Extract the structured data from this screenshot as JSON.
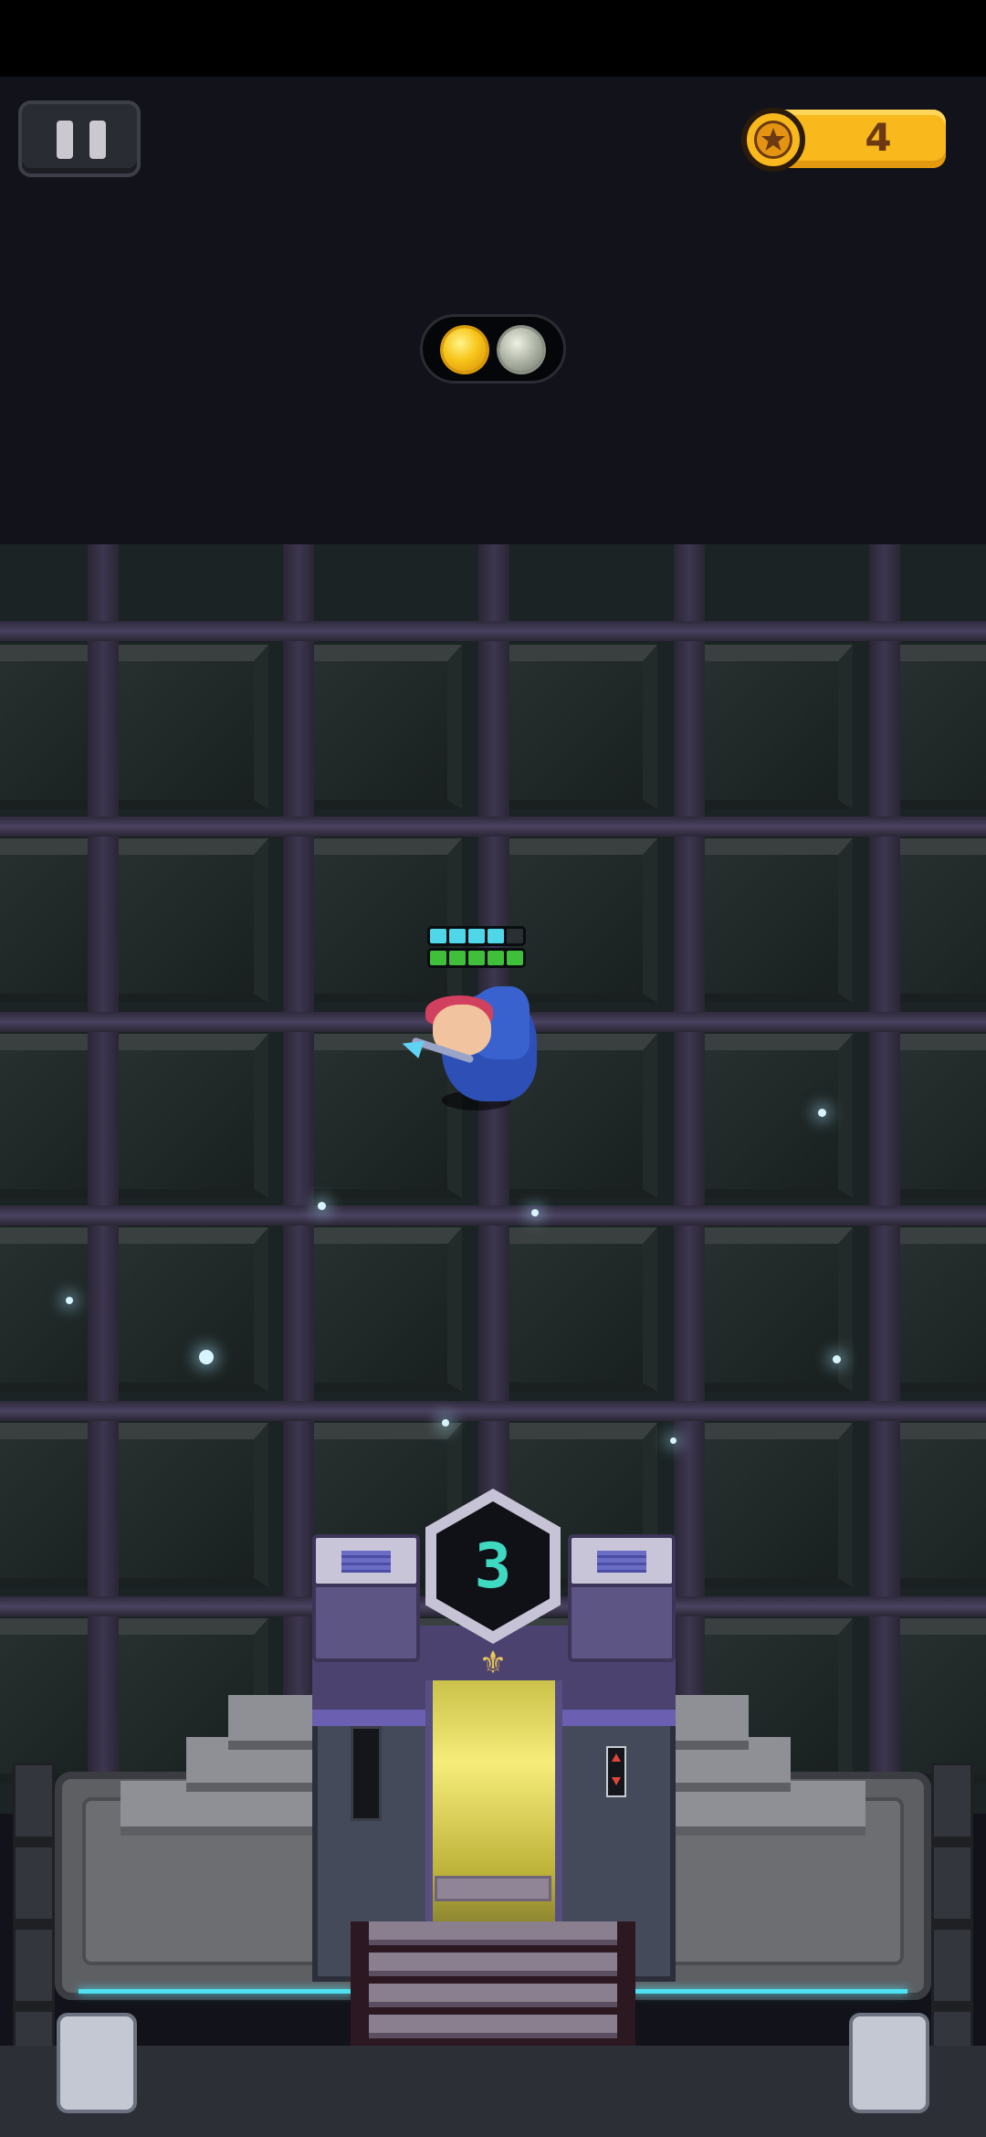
{
  "hud": {
    "coins": "4",
    "coin_icon": "star-coin-icon",
    "pause_icon": "pause-icon",
    "stage_orbs": [
      {
        "state": "completed",
        "color": "#f7c51a"
      },
      {
        "state": "locked",
        "color": "#8f9a90"
      }
    ]
  },
  "hero": {
    "shield_segments_filled": 4,
    "shield_segments_total": 5,
    "health_segments_filled": 5,
    "health_segments_total": 5,
    "shield_color": "#4fd6e8",
    "health_color": "#3fbf3a"
  },
  "gate": {
    "level_number": "3",
    "emblem": "fleur-de-lis-icon"
  },
  "colors": {
    "accent_cyan": "#4fe1f2",
    "coin_gold": "#f9b81b"
  }
}
